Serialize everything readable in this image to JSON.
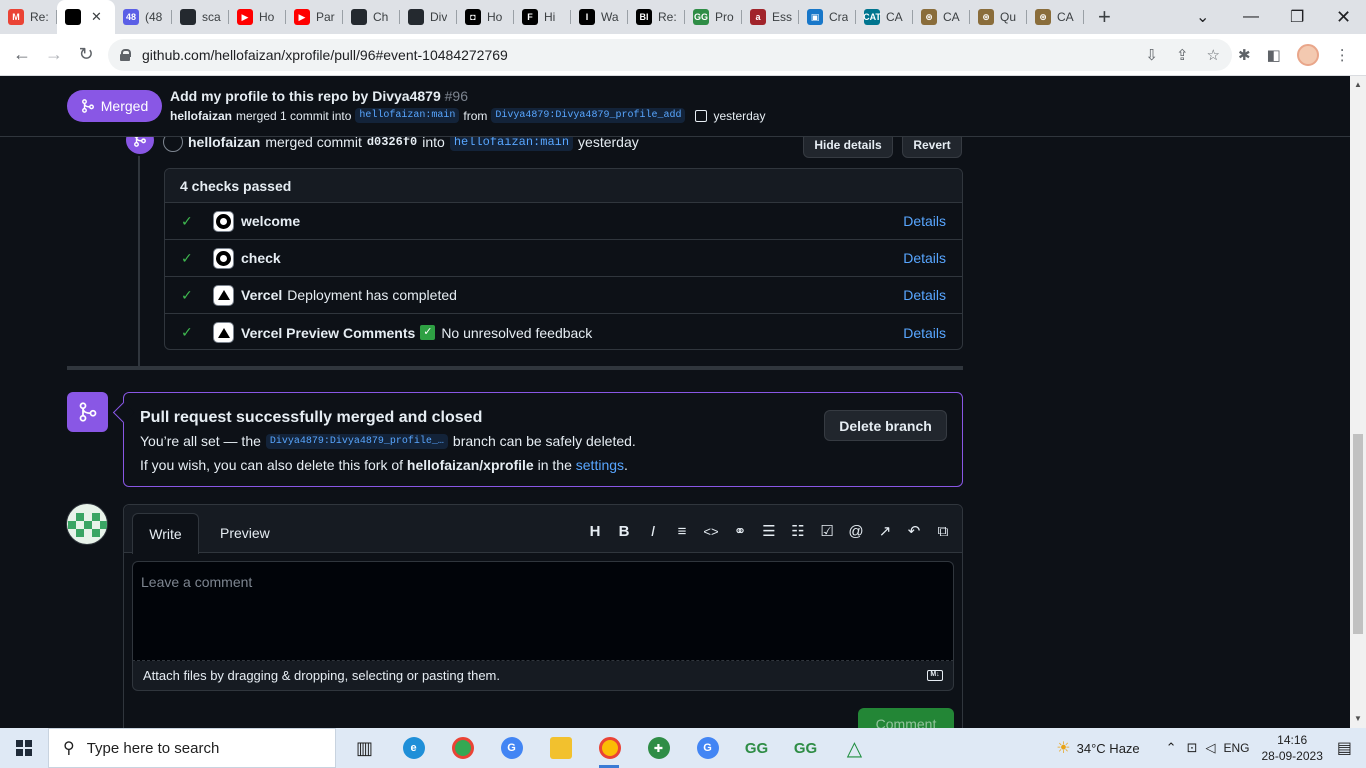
{
  "browser": {
    "tabs": [
      {
        "title": "Re:",
        "color": "#ea4335",
        "glyph": "M"
      },
      {
        "title": "",
        "color": "#000000",
        "glyph": "",
        "active": true
      },
      {
        "title": "(48",
        "color": "#5b5fe6",
        "glyph": "48"
      },
      {
        "title": "sca",
        "color": "#24292f",
        "glyph": ""
      },
      {
        "title": "Ho",
        "color": "#ff0000",
        "glyph": "▶"
      },
      {
        "title": "Par",
        "color": "#ff0000",
        "glyph": "▶"
      },
      {
        "title": "Ch",
        "color": "#24292f",
        "glyph": ""
      },
      {
        "title": "Div",
        "color": "#24292f",
        "glyph": ""
      },
      {
        "title": "Ho",
        "color": "#000000",
        "glyph": "◘"
      },
      {
        "title": "Hi",
        "color": "#000000",
        "glyph": "F"
      },
      {
        "title": "Wa",
        "color": "#000000",
        "glyph": "I"
      },
      {
        "title": "Re:",
        "color": "#000000",
        "glyph": "BI"
      },
      {
        "title": "Pro",
        "color": "#2f8d46",
        "glyph": "GG"
      },
      {
        "title": "Ess",
        "color": "#a1242b",
        "glyph": "a"
      },
      {
        "title": "Cra",
        "color": "#1877c9",
        "glyph": "▣"
      },
      {
        "title": "CA",
        "color": "#00758f",
        "glyph": "CAT"
      },
      {
        "title": "CA",
        "color": "#8a6d3b",
        "glyph": "⊛"
      },
      {
        "title": "Qu",
        "color": "#8a6d3b",
        "glyph": "⊛"
      },
      {
        "title": "CA",
        "color": "#8a6d3b",
        "glyph": "⊛"
      }
    ],
    "url": "github.com/hellofaizan/xprofile/pull/96#event-10484272769"
  },
  "pr": {
    "state": "Merged",
    "title": "Add my profile to this repo by Divya4879",
    "number": "#96",
    "merger": "hellofaizan",
    "merge_text": "merged 1 commit into",
    "base_ref": "hellofaizan:main",
    "from_text": "from",
    "head_ref": "Divya4879:Divya4879_profile_add",
    "when": "yesterday"
  },
  "event": {
    "actor": "hellofaizan",
    "action": "merged commit",
    "commit": "d0326f0",
    "into": "into",
    "ref": "hellofaizan:main",
    "when": "yesterday",
    "hide_details": "Hide details",
    "revert": "Revert"
  },
  "checks": {
    "header": "4 checks passed",
    "details_label": "Details",
    "items": [
      {
        "name": "welcome",
        "desc": "",
        "icon": "github"
      },
      {
        "name": "check",
        "desc": "",
        "icon": "github"
      },
      {
        "name": "Vercel",
        "desc": "Deployment has completed",
        "icon": "vercel"
      },
      {
        "name": "Vercel Preview Comments",
        "desc": "No unresolved feedback",
        "icon": "vercel",
        "badge": "✓"
      }
    ]
  },
  "merge_box": {
    "title": "Pull request successfully merged and closed",
    "line1_pre": "You’re all set — the",
    "branch": "Divya4879:Divya4879_profile_…",
    "line1_post": "branch can be safely deleted.",
    "line2_pre": "If you wish, you can also delete this fork of",
    "repo": "hellofaizan/xprofile",
    "line2_mid": "in the",
    "settings": "settings",
    "line2_end": ".",
    "delete_branch": "Delete branch"
  },
  "comment": {
    "tab_write": "Write",
    "tab_preview": "Preview",
    "placeholder": "Leave a comment",
    "attach": "Attach files by dragging & dropping, selecting or pasting them.",
    "submit": "Comment"
  },
  "taskbar": {
    "search": "Type here to search",
    "weather": "34°C  Haze",
    "lang": "ENG",
    "time": "14:16",
    "date": "28-09-2023"
  }
}
